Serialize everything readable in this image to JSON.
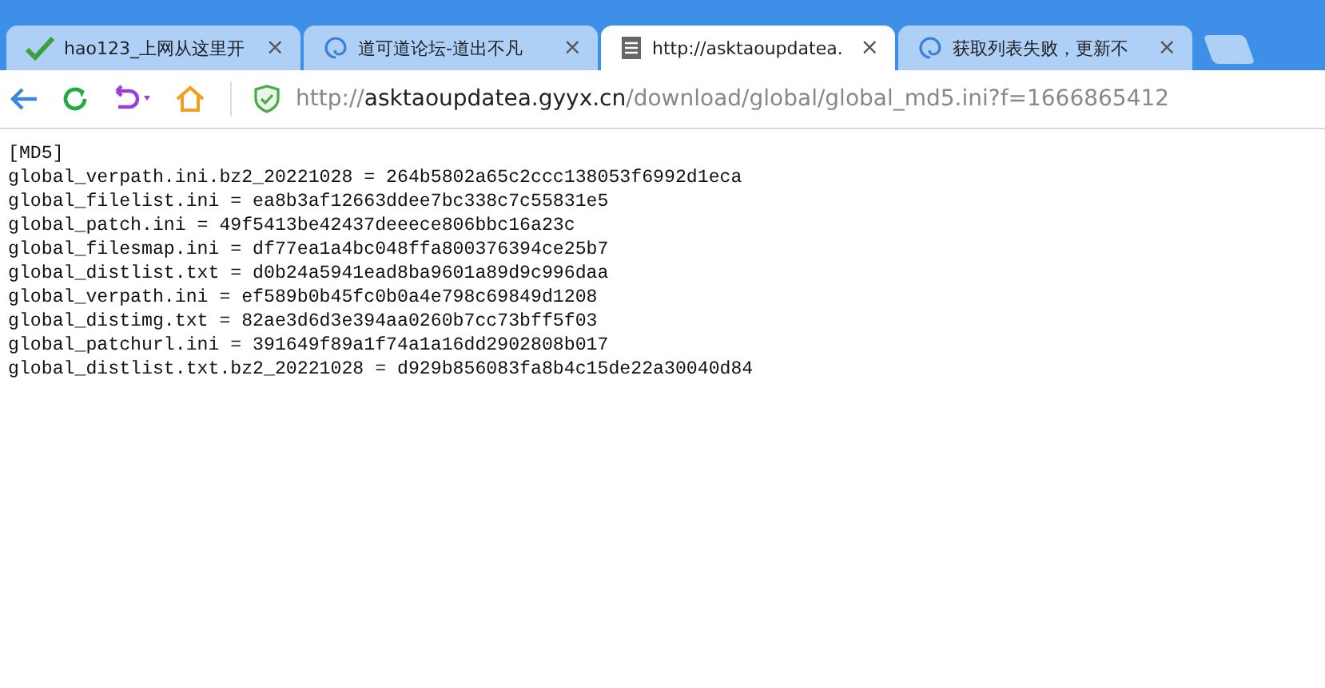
{
  "tabs": [
    {
      "title": "hao123_上网从这里开",
      "selected": false,
      "close": "×"
    },
    {
      "title": "道可道论坛-道出不凡",
      "selected": false,
      "close": "×"
    },
    {
      "title": "http://asktaoupdatea.",
      "selected": true,
      "close": "×"
    },
    {
      "title": "获取列表失败，更新不",
      "selected": false,
      "close": "×"
    }
  ],
  "address": {
    "scheme": "http://",
    "host": "asktaoupdatea.gyyx.cn",
    "path": "/download/global/global_md5.ini?f=1666865412"
  },
  "lines": [
    "[MD5]",
    "global_verpath.ini.bz2_20221028 = 264b5802a65c2ccc138053f6992d1eca",
    "global_filelist.ini = ea8b3af12663ddee7bc338c7c55831e5",
    "global_patch.ini = 49f5413be42437deeece806bbc16a23c",
    "global_filesmap.ini = df77ea1a4bc048ffa800376394ce25b7",
    "global_distlist.txt = d0b24a5941ead8ba9601a89d9c996daa",
    "global_verpath.ini = ef589b0b45fc0b0a4e798c69849d1208",
    "global_distimg.txt = 82ae3d6d3e394aa0260b7cc73bff5f03",
    "global_patchurl.ini = 391649f89a1f74a1a16dd2902808b017",
    "global_distlist.txt.bz2_20221028 = d929b856083fa8b4c15de22a30040d84"
  ]
}
